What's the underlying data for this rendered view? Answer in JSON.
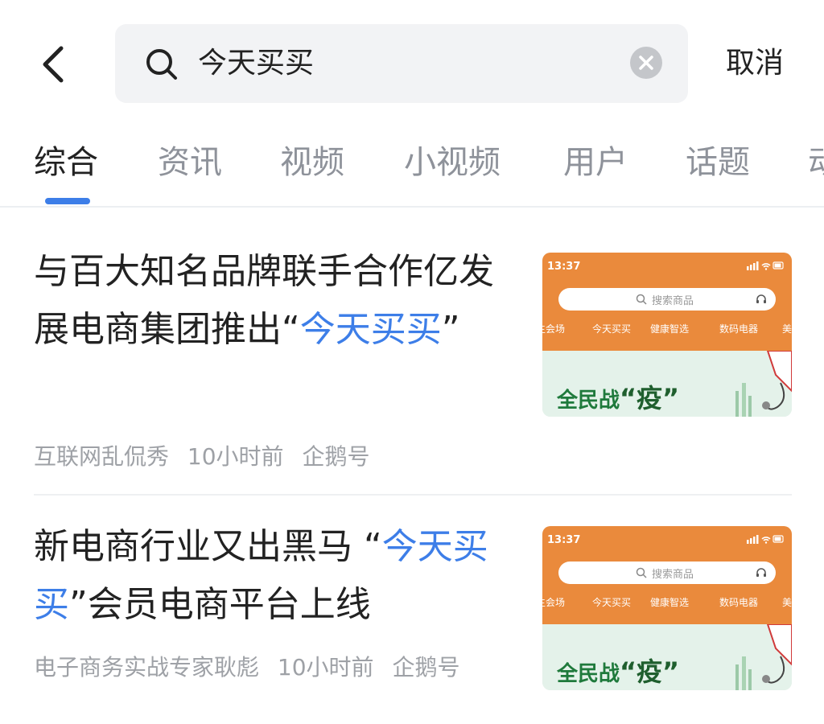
{
  "search": {
    "query": "今天买买",
    "cancel_label": "取消"
  },
  "tabs": [
    {
      "label": "综合",
      "active": true
    },
    {
      "label": "资讯"
    },
    {
      "label": "视频"
    },
    {
      "label": "小视频"
    },
    {
      "label": "用户"
    },
    {
      "label": "话题"
    },
    {
      "label": "动"
    }
  ],
  "results": [
    {
      "title_before": "与百大知名品牌联手合作亿发展电商集团推出“",
      "title_highlight": "今天买买",
      "title_after": "”",
      "author": "互联网乱侃秀",
      "time": "10小时前",
      "source": "企鹅号",
      "thumbnail": {
        "time": "13:37",
        "search_placeholder": "搜索商品",
        "nav": [
          "主会场",
          "今天买买",
          "健康智选",
          "数码电器",
          "美"
        ],
        "slogan_prefix": "全民战",
        "slogan_emph": "“疫”"
      }
    },
    {
      "title_before": "新电商行业又出黑马 “",
      "title_highlight": "今天买买",
      "title_after": "”会员电商平台上线",
      "author": "电子商务实战专家耿彪",
      "time": "10小时前",
      "source": "企鹅号",
      "thumbnail": {
        "time": "13:37",
        "search_placeholder": "搜索商品",
        "nav": [
          "主会场",
          "今天买买",
          "健康智选",
          "数码电器",
          "美"
        ],
        "slogan_prefix": "全民战",
        "slogan_emph": "“疫”"
      }
    }
  ],
  "colors": {
    "accent": "#3d7ee8",
    "thumb_orange": "#ea8a3c",
    "thumb_green": "#1f7a3c"
  }
}
